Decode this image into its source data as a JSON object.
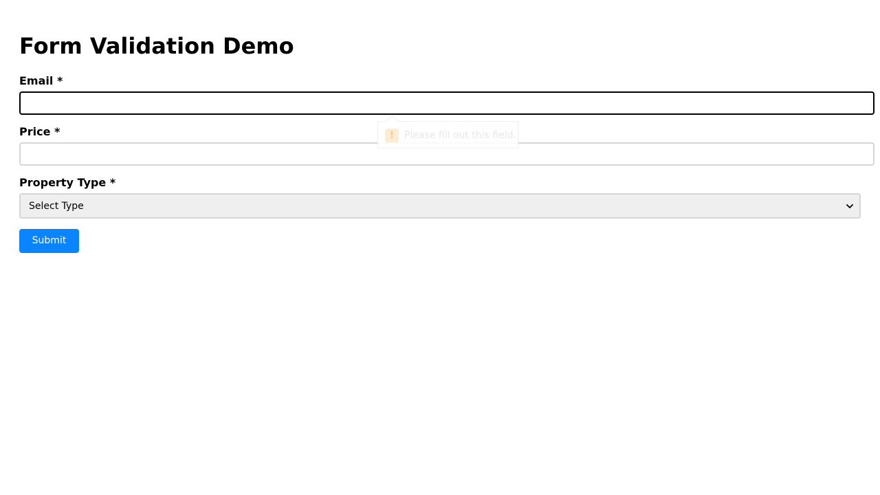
{
  "form": {
    "title": "Form Validation Demo",
    "email": {
      "label": "Email *",
      "value": "",
      "placeholder": ""
    },
    "price": {
      "label": "Price *",
      "value": "",
      "placeholder": ""
    },
    "property_type": {
      "label": "Property Type *",
      "selected": "Select Type"
    },
    "submit_label": "Submit"
  },
  "validation_tooltip": {
    "icon": "warning-icon",
    "icon_glyph": "!",
    "message": "Please fill out this field."
  },
  "colors": {
    "accent": "#0b84ff",
    "focus_border": "#000000",
    "input_border": "#d6d6d6",
    "select_background": "#efefef"
  }
}
